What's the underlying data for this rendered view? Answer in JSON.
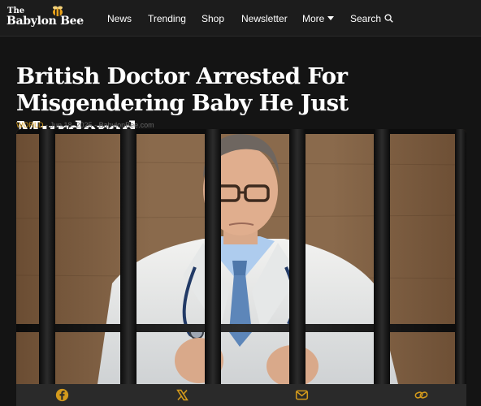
{
  "site": {
    "logo_the": "The",
    "logo_name": "Babylon Bee"
  },
  "nav": {
    "news": "News",
    "trending": "Trending",
    "shop": "Shop",
    "newsletter": "Newsletter",
    "more": "More",
    "search": "Search"
  },
  "article": {
    "title": "British Doctor Arrested For Misgendering Baby He Just Murdered",
    "category": "WORLD",
    "date": "Jun 18, 2025",
    "source": "BabylonBee.com"
  },
  "share": {
    "icons": [
      "facebook-icon",
      "x-icon",
      "email-icon",
      "link-icon"
    ]
  },
  "colors": {
    "background": "#141414",
    "accent": "#d39a1c",
    "nav_bg": "#1c1c1c",
    "share_bar": "#2a2a2a"
  }
}
